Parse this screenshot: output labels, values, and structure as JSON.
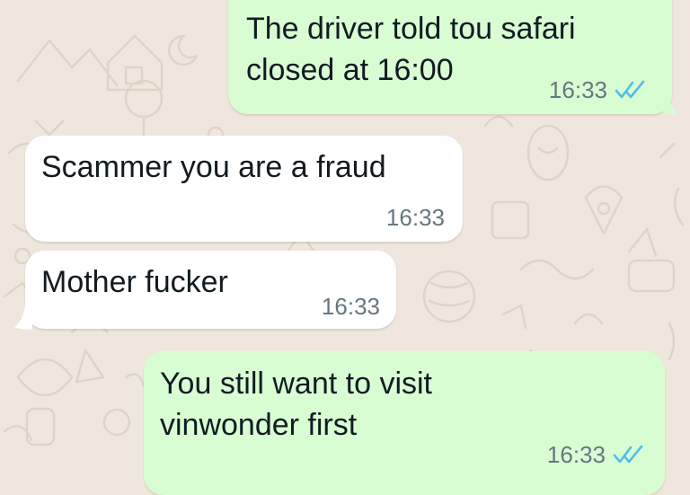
{
  "conversation": {
    "messages": [
      {
        "direction": "outgoing",
        "lines": [
          "The driver told tou safari",
          "closed at 16:00"
        ],
        "time": "16:33",
        "status": "read",
        "status_icon": "double-check-icon"
      },
      {
        "direction": "incoming",
        "lines": [
          "Scammer you are a fraud"
        ],
        "time": "16:33"
      },
      {
        "direction": "incoming",
        "lines": [
          "Mother fucker"
        ],
        "time": "16:33"
      },
      {
        "direction": "outgoing",
        "lines": [
          "You still want to visit",
          "vinwonder first"
        ],
        "time": "16:33",
        "status": "read",
        "status_icon": "double-check-icon"
      }
    ]
  },
  "colors": {
    "wallpaper": "#efe7dd",
    "outgoing_bubble": "#d9fdd3",
    "incoming_bubble": "#ffffff",
    "read_ticks": "#53bdeb",
    "time_text": "#667781",
    "message_text": "#111b21"
  }
}
